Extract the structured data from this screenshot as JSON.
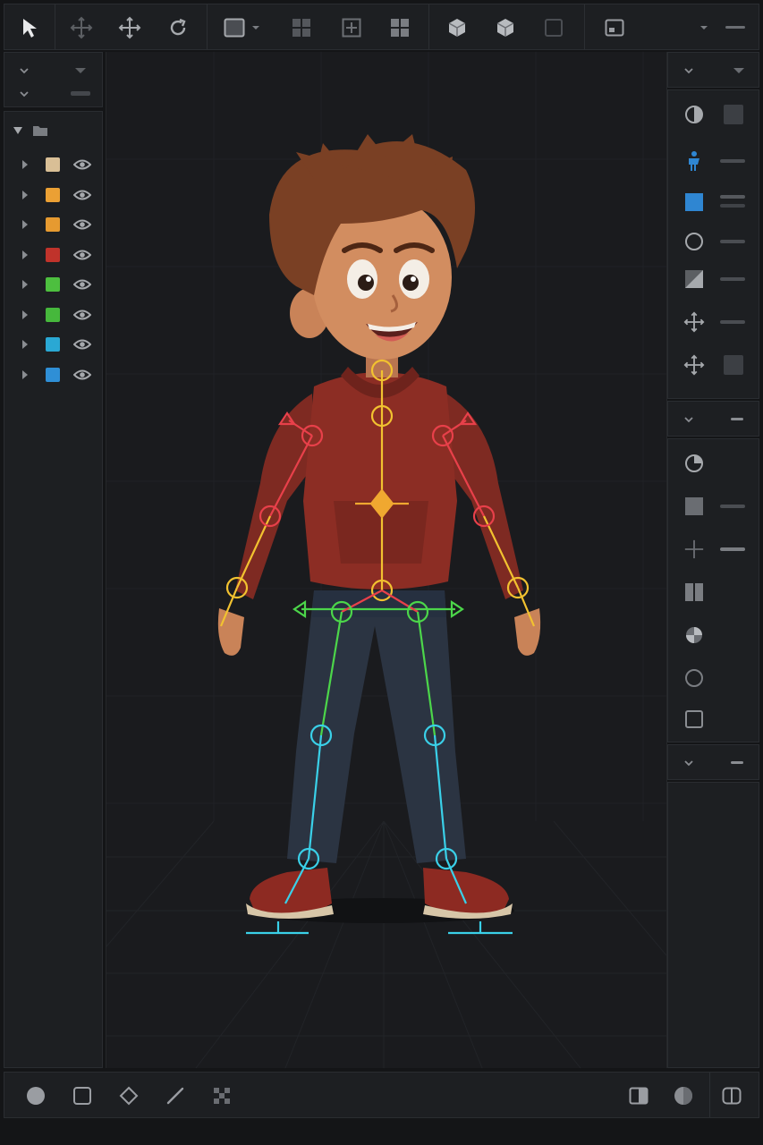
{
  "toolbar": {
    "tools": [
      {
        "name": "select-tool",
        "icon": "arrow-pointer-icon",
        "active": true
      },
      {
        "name": "move-light-tool",
        "icon": "move-light-icon"
      },
      {
        "name": "move-tool",
        "icon": "move-icon"
      },
      {
        "name": "rotate-tool",
        "icon": "rotate-icon"
      },
      {
        "name": "shape-tool",
        "icon": "square-icon"
      },
      {
        "name": "grid-tool",
        "icon": "grid-icon"
      },
      {
        "name": "grid-add-tool",
        "icon": "grid-plus-icon"
      },
      {
        "name": "grid-alt-tool",
        "icon": "grid-icon"
      },
      {
        "name": "cube-tool",
        "icon": "cube-icon"
      },
      {
        "name": "cube-alt-tool",
        "icon": "cube-icon"
      },
      {
        "name": "frame-tool",
        "icon": "square-outline-icon"
      },
      {
        "name": "window-tool",
        "icon": "window-icon"
      }
    ]
  },
  "layers": {
    "root_icon": "folder-icon",
    "items": [
      {
        "color": "#d9bf96",
        "visible": true
      },
      {
        "color": "#eba034",
        "visible": true
      },
      {
        "color": "#e69a30",
        "visible": true
      },
      {
        "color": "#c0332b",
        "visible": true
      },
      {
        "color": "#4dbf3f",
        "visible": true
      },
      {
        "color": "#46b83c",
        "visible": true
      },
      {
        "color": "#2aa8d4",
        "visible": true
      },
      {
        "color": "#2f8fd6",
        "visible": true
      }
    ]
  },
  "rig": {
    "colors": {
      "spine": "#f2c230",
      "arm_left": "#e8404a",
      "arm_right": "#e8404a",
      "forearm": "#f2c230",
      "hips": "#4cd64a",
      "legs": "#3ad0e8",
      "root": "#f0a830"
    }
  },
  "right_panel": {
    "accent": "#2f86d2",
    "icons": [
      "contrast-icon",
      "figure-icon",
      "blue-square-icon",
      "circle-icon",
      "gradient-icon",
      "move-icon",
      "move-icon",
      "pie-icon",
      "square-icon",
      "move-light-icon",
      "columns-icon",
      "sphere-icon",
      "circle-icon",
      "square-outline-icon"
    ]
  },
  "bottom_bar": {
    "icons": [
      "circle-icon",
      "square-icon",
      "diamond-icon",
      "line-icon",
      "checker-icon",
      "split-icon",
      "sphere-icon",
      "split-alt-icon"
    ]
  }
}
